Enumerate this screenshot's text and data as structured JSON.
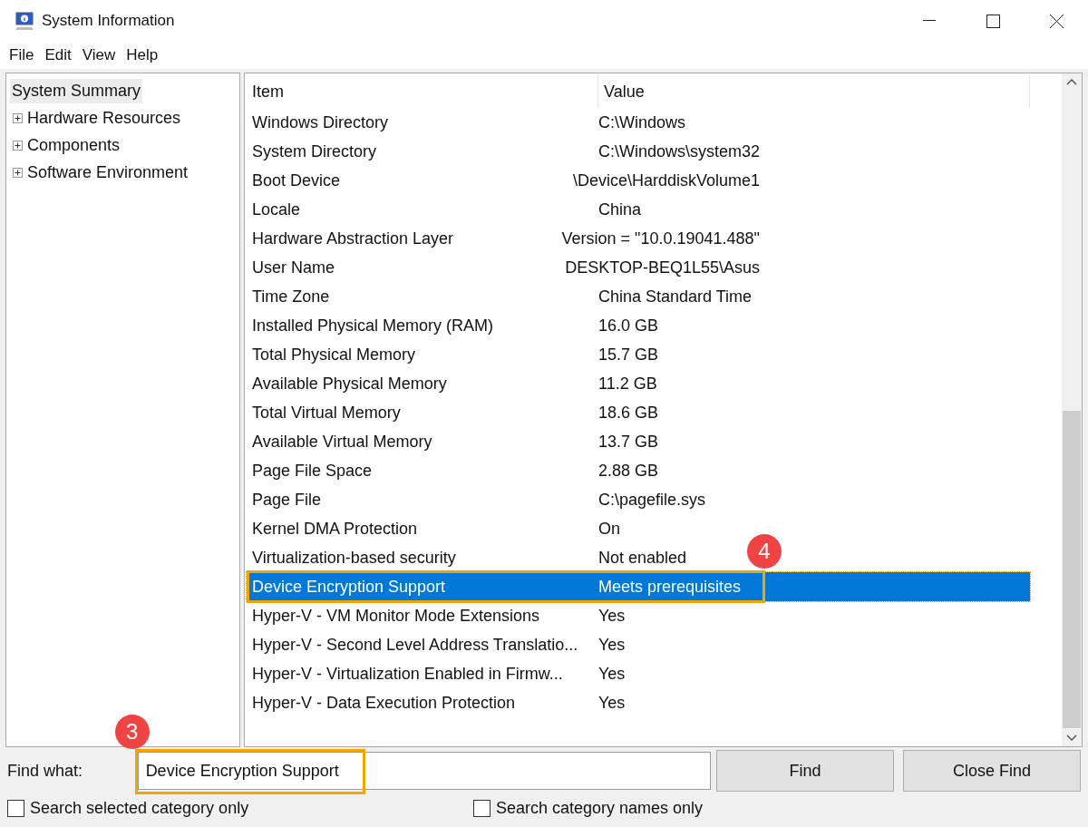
{
  "window": {
    "title": "System Information"
  },
  "menu": [
    "File",
    "Edit",
    "View",
    "Help"
  ],
  "tree": [
    {
      "label": "System Summary",
      "selected": true,
      "children": [
        {
          "label": "Hardware Resources",
          "selected": false,
          "expanded": false
        },
        {
          "label": "Components",
          "selected": false,
          "expanded": false
        },
        {
          "label": "Software Environment",
          "selected": false,
          "expanded": false
        }
      ]
    }
  ],
  "table": {
    "columns": [
      "Item",
      "Value"
    ],
    "rows": [
      {
        "item": "Windows Directory",
        "value": "C:\\Windows",
        "selected": false
      },
      {
        "item": "System Directory",
        "value": "C:\\Windows\\system32",
        "selected": false
      },
      {
        "item": "Boot Device",
        "value": "\\Device\\HarddiskVolume1",
        "selected": false
      },
      {
        "item": "Locale",
        "value": "China",
        "selected": false
      },
      {
        "item": "Hardware Abstraction Layer",
        "value": "Version = \"10.0.19041.488\"",
        "selected": false
      },
      {
        "item": "User Name",
        "value": "DESKTOP-BEQ1L55\\Asus",
        "selected": false
      },
      {
        "item": "Time Zone",
        "value": "China Standard Time",
        "selected": false
      },
      {
        "item": "Installed Physical Memory (RAM)",
        "value": "16.0 GB",
        "selected": false
      },
      {
        "item": "Total Physical Memory",
        "value": "15.7 GB",
        "selected": false
      },
      {
        "item": "Available Physical Memory",
        "value": "11.2 GB",
        "selected": false
      },
      {
        "item": "Total Virtual Memory",
        "value": "18.6 GB",
        "selected": false
      },
      {
        "item": "Available Virtual Memory",
        "value": "13.7 GB",
        "selected": false
      },
      {
        "item": "Page File Space",
        "value": "2.88 GB",
        "selected": false
      },
      {
        "item": "Page File",
        "value": "C:\\pagefile.sys",
        "selected": false
      },
      {
        "item": "Kernel DMA Protection",
        "value": "On",
        "selected": false
      },
      {
        "item": "Virtualization-based security",
        "value": "Not enabled",
        "selected": false
      },
      {
        "item": "Device Encryption Support",
        "value": "Meets prerequisites",
        "selected": true,
        "callout": "4"
      },
      {
        "item": "Hyper-V - VM Monitor Mode Extensions",
        "value": "Yes",
        "selected": false
      },
      {
        "item": "Hyper-V - Second Level Address Translatio...",
        "value": "Yes",
        "selected": false
      },
      {
        "item": "Hyper-V - Virtualization Enabled in Firmw...",
        "value": "Yes",
        "selected": false
      },
      {
        "item": "Hyper-V - Data Execution Protection",
        "value": "Yes",
        "selected": false
      }
    ]
  },
  "find": {
    "label": "Find what:",
    "value": "Device Encryption Support",
    "callout": "3",
    "buttons": [
      "Find",
      "Close Find"
    ],
    "options": [
      {
        "label": "Search selected category only",
        "checked": false
      },
      {
        "label": "Search category names only",
        "checked": false
      }
    ]
  }
}
